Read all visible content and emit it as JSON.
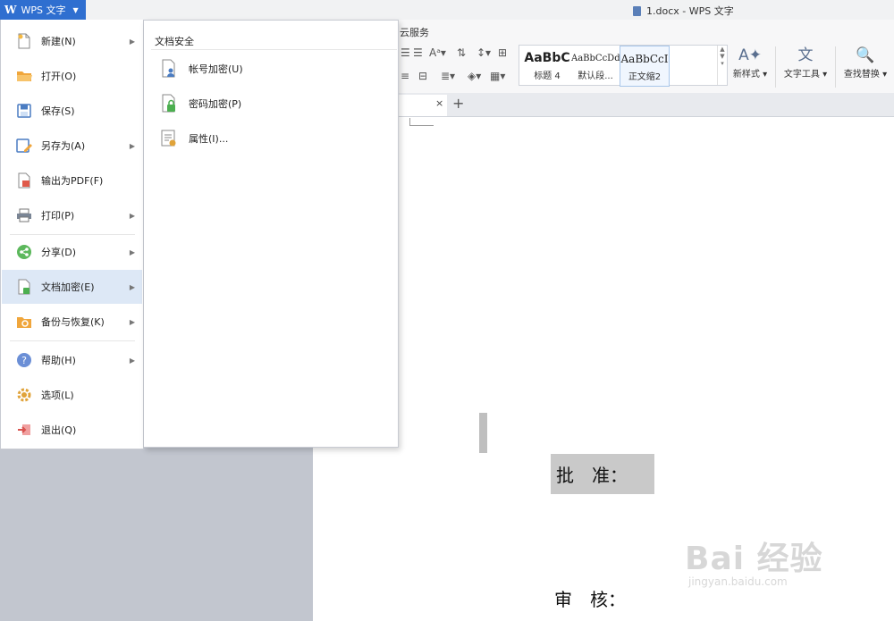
{
  "app": {
    "button_logo": "W",
    "button_label": "WPS 文字",
    "window_title": "1.docx - WPS 文字"
  },
  "ribbon": {
    "tab_cloud": "云服务",
    "styles": [
      {
        "sample": "AaBbC",
        "name": "标题 4"
      },
      {
        "sample": "AaBbCcDd",
        "name": "默认段..."
      },
      {
        "sample": "AaBbCcI",
        "name": "正文缩2"
      }
    ],
    "new_style": "新样式",
    "text_tools": "文字工具",
    "find_replace": "查找替换"
  },
  "doctab": {
    "close": "×",
    "add": "+"
  },
  "menu": {
    "items": [
      {
        "label": "新建(N)",
        "icon": "new-doc-icon",
        "arrow": true
      },
      {
        "label": "打开(O)",
        "icon": "open-folder-icon",
        "arrow": false
      },
      {
        "label": "保存(S)",
        "icon": "save-icon",
        "arrow": false
      },
      {
        "label": "另存为(A)",
        "icon": "save-as-icon",
        "arrow": true
      },
      {
        "label": "输出为PDF(F)",
        "icon": "pdf-icon",
        "arrow": false
      },
      {
        "label": "打印(P)",
        "icon": "print-icon",
        "arrow": true
      },
      {
        "label": "分享(D)",
        "icon": "share-icon",
        "arrow": true
      },
      {
        "label": "文档加密(E)",
        "icon": "doc-encrypt-icon",
        "arrow": true
      },
      {
        "label": "备份与恢复(K)",
        "icon": "backup-icon",
        "arrow": true
      },
      {
        "label": "帮助(H)",
        "icon": "help-icon",
        "arrow": true
      },
      {
        "label": "选项(L)",
        "icon": "gear-icon",
        "arrow": false
      },
      {
        "label": "退出(Q)",
        "icon": "exit-icon",
        "arrow": false
      }
    ]
  },
  "submenu": {
    "heading": "文档安全",
    "items": [
      {
        "label": "帐号加密(U)",
        "icon": "account-lock-icon"
      },
      {
        "label": "密码加密(P)",
        "icon": "password-lock-icon"
      },
      {
        "label": "属性(I)...",
        "icon": "properties-icon"
      }
    ]
  },
  "document": {
    "line1": "批　准：",
    "line2": "审　核："
  },
  "watermark": {
    "brand": "Bai 经验",
    "url": "jingyan.baidu.com"
  },
  "colors": {
    "accent": "#2f6fd0",
    "menu_active": "#dde8f6",
    "background": "#c2c6cf"
  }
}
